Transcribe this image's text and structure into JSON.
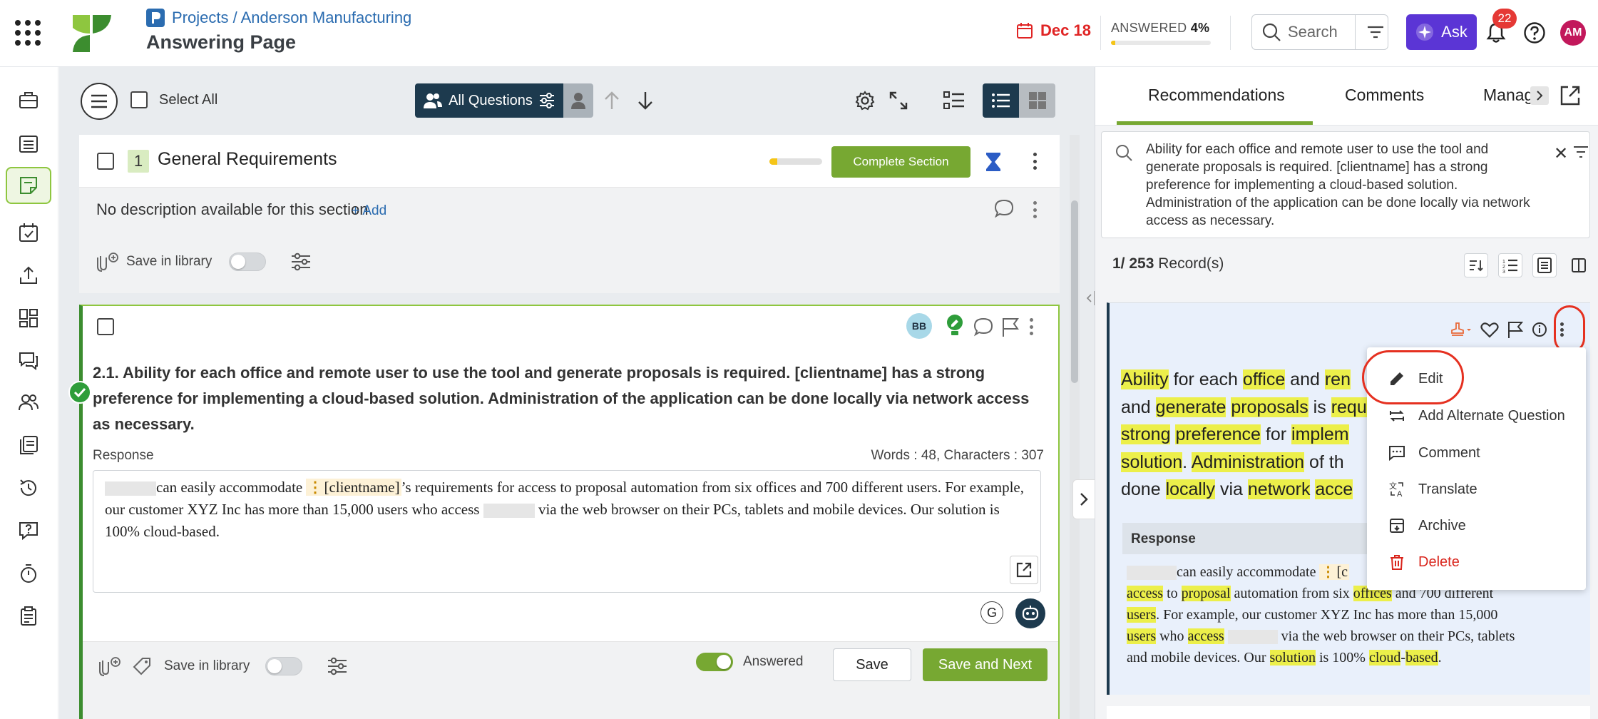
{
  "header": {
    "breadcrumb": "Projects / Anderson Manufacturing",
    "page_title": "Answering Page",
    "due_date": "Dec 18",
    "answered_label": "ANSWERED",
    "answered_pct_text": "4%",
    "answered_pct": 4,
    "search_placeholder": "Search",
    "ask_label": "Ask",
    "notif_count": "22",
    "avatar_initials": "AM",
    "accent": "#5b35d5",
    "alert_color": "#e02424"
  },
  "nav": {
    "items": [
      {
        "icon": "briefcase-icon"
      },
      {
        "icon": "list-icon"
      },
      {
        "icon": "note-icon",
        "active": true
      },
      {
        "icon": "calendar-check-icon"
      },
      {
        "icon": "upload-icon"
      },
      {
        "icon": "dashboard-icon"
      },
      {
        "icon": "chat-icon"
      },
      {
        "icon": "users-icon"
      },
      {
        "icon": "library-icon"
      },
      {
        "icon": "history-icon"
      },
      {
        "icon": "question-icon"
      },
      {
        "icon": "timer-icon"
      },
      {
        "icon": "clipboard-icon"
      }
    ]
  },
  "toolbar": {
    "select_all": "Select All",
    "all_questions": "All Questions"
  },
  "section": {
    "number": "1",
    "title": "General Requirements",
    "progress_pct": 15,
    "complete_label": "Complete Section",
    "no_description": "No description available for this section",
    "add_label": "+ Add",
    "save_in_library": "Save in library"
  },
  "question": {
    "assignee": "BB",
    "text": "2.1. Ability for each office and remote user to use the tool and generate proposals is required.  [clientname] has a strong preference for implementing a cloud-based solution.  Administration of the application can be done locally via network access as necessary.",
    "response_label": "Response",
    "word_count": "Words : 48, Characters : 307",
    "response_parts": {
      "a": "can easily accommodate ",
      "tag": "[clientname]",
      "b": "’s requirements for access to proposal automation from six offices and 700 different users. For example, our customer XYZ Inc has more than 15,000 users who access ",
      "c": " via the web browser on their PCs, tablets and mobile devices.  Our solution is 100% cloud-based."
    },
    "save_in_library": "Save in library",
    "answered_label": "Answered",
    "save_label": "Save",
    "save_next_label": "Save and Next"
  },
  "right_panel": {
    "tabs": [
      "Recommendations",
      "Comments",
      "Manag"
    ],
    "search_text": "Ability for each office and remote user to use the tool and generate proposals is required.  [clientname] has a strong preference for implementing a cloud-based solution.  Administration of the application can be done locally via network access as necessary.",
    "records_count": "1/ 253",
    "records_label": "Record(s)",
    "rec_question": {
      "w1": "Ability",
      "t1": " for each ",
      "w2": "office",
      "t2": " and ",
      "w3": "ren",
      "t3": "and ",
      "w4": "generate",
      "t4": " ",
      "w5": "proposals",
      "t5": " is ",
      "w6": "requ",
      "w7": "strong",
      "t6": " ",
      "w8": "preference",
      "t7": " for ",
      "w9": "implem",
      "w10": "solution",
      "t8": ". ",
      "w11": "Administration",
      "t9": " of th",
      "t10": "done ",
      "w12": "locally",
      "t11": " via ",
      "w13": "network",
      "t12": " ",
      "w14": "acce"
    },
    "rec_response_label": "Response",
    "rec_response": {
      "a": "can easily accommodate ",
      "tag": "[c",
      "w1": "access",
      "t1": " to ",
      "w2": "proposal",
      "t2": " automation from six ",
      "w3": "offices",
      "t3": " and 700 different",
      "w4": "users",
      "t4": ". For example, our customer XYZ Inc has more than 15,000",
      "w5": "users",
      "t5": " who ",
      "w6": "access",
      "t6": " via the web browser on their PCs, tablets",
      "t7": "and mobile devices.  Our ",
      "w7": "solution",
      "t8": " is 100% ",
      "w8": "cloud",
      "t9": "-",
      "w9": "based",
      "t10": "."
    },
    "menu": [
      {
        "label": "Edit",
        "icon": "pencil-icon"
      },
      {
        "label": "Add Alternate Question",
        "icon": "swap-icon"
      },
      {
        "label": "Comment",
        "icon": "comment-icon"
      },
      {
        "label": "Translate",
        "icon": "translate-icon"
      },
      {
        "label": "Archive",
        "icon": "archive-icon"
      },
      {
        "label": "Delete",
        "icon": "trash-icon"
      }
    ],
    "highlight_color": "#ecef4a",
    "delete_color": "#d9251c"
  }
}
